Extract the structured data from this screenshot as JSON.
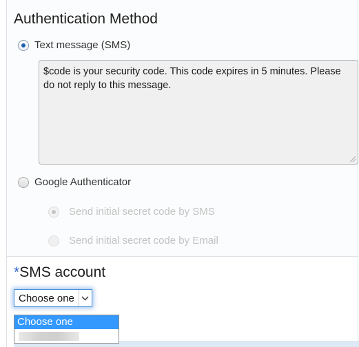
{
  "auth_method": {
    "title": "Authentication Method",
    "sms_option": {
      "label": "Text message (SMS)",
      "selected": true
    },
    "sms_message": "$code is your security code. This code expires in 5 minutes. Please do not reply to this message.",
    "google_option": {
      "label": "Google Authenticator",
      "selected": false
    },
    "google_suboptions": [
      {
        "label": "Send initial secret code by SMS",
        "selected": true,
        "disabled": true
      },
      {
        "label": "Send initial secret code by Email",
        "selected": false,
        "disabled": true
      }
    ]
  },
  "sms_account": {
    "required_marker": "*",
    "title": "SMS account",
    "selected_value": "Choose one",
    "options": [
      "Choose one"
    ]
  },
  "colors": {
    "accent": "#1e5fb3",
    "option_highlight": "#3399ff",
    "focus_ring": "#4a90d9",
    "required_marker": "#3366cc"
  }
}
